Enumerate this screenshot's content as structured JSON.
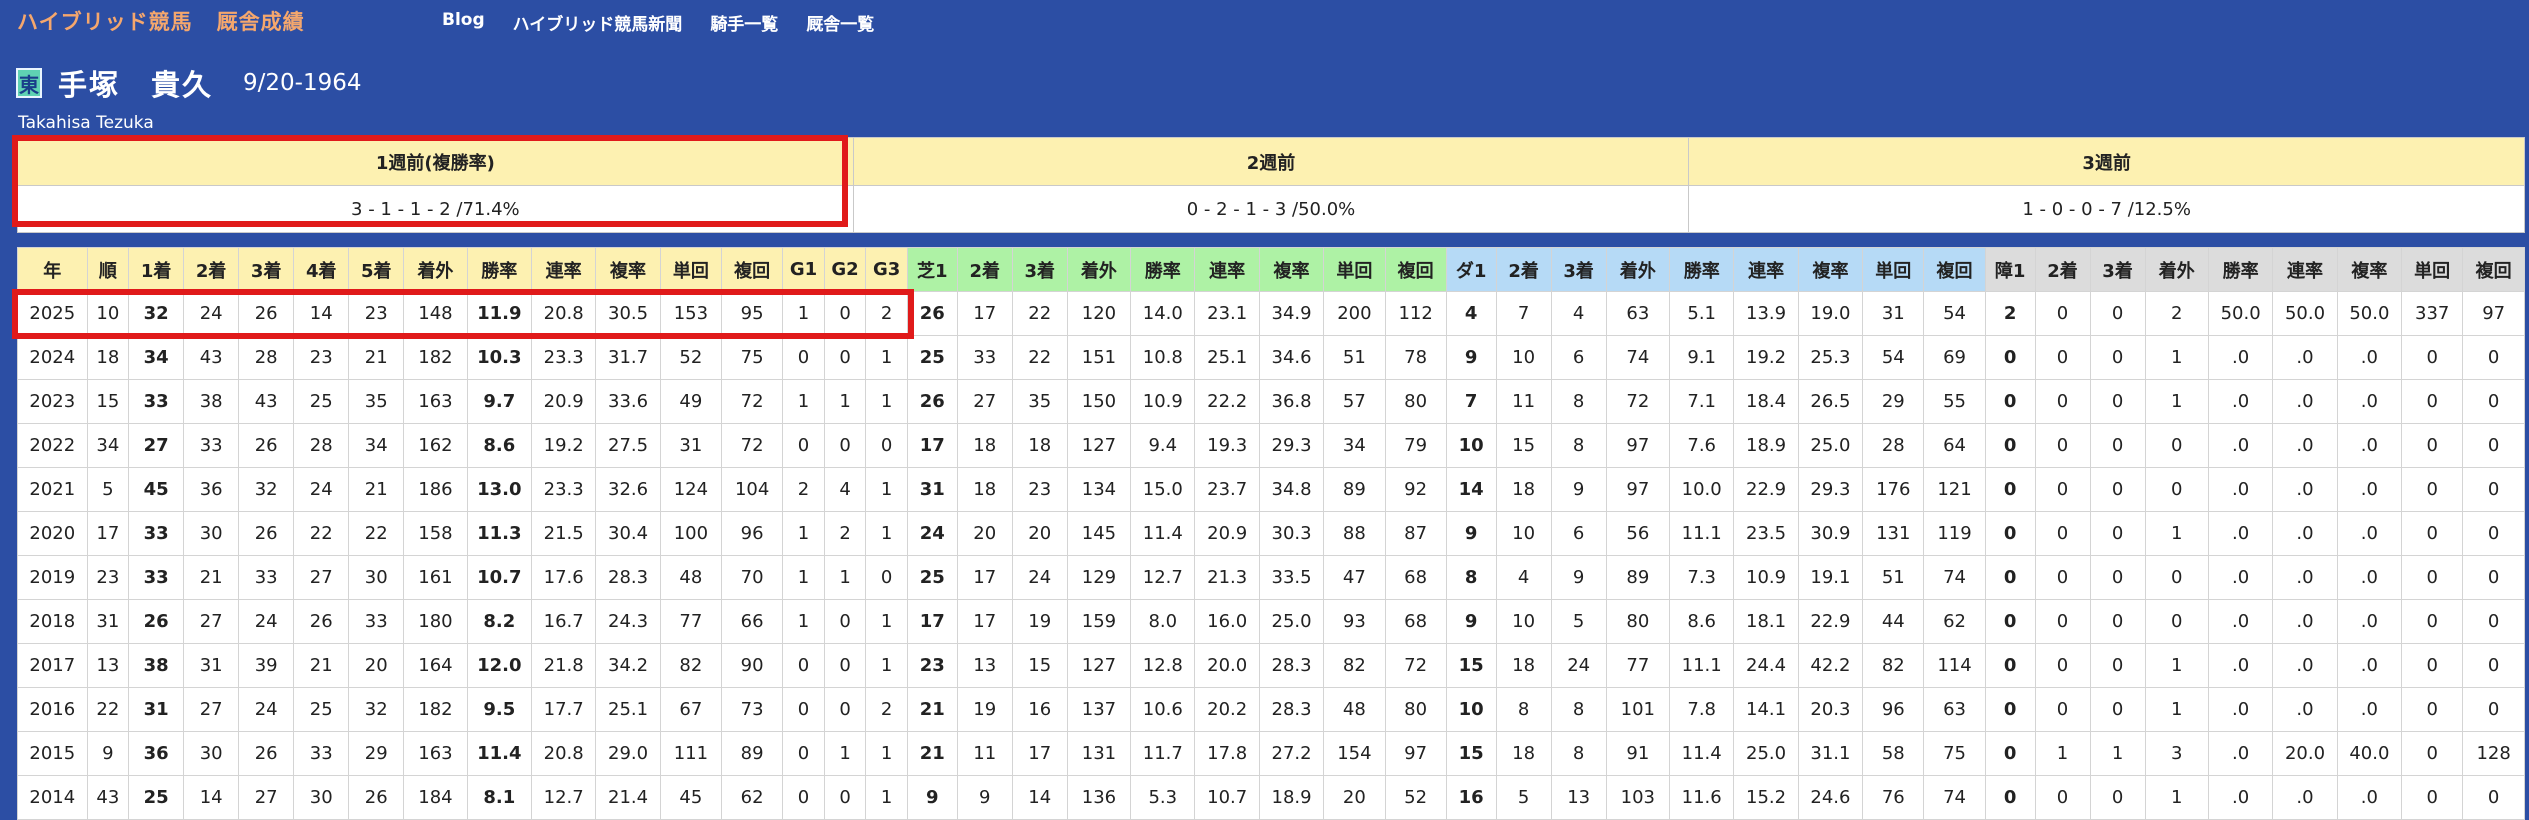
{
  "header": {
    "brand_main": "ハイブリッド競馬",
    "brand_sub": "厩舎成績",
    "nav": [
      "Blog",
      "ハイブリッド競馬新聞",
      "騎手一覧",
      "厩舎一覧"
    ]
  },
  "trainer": {
    "affiliation": "東",
    "name": "手塚　貴久",
    "dob": "9/20-1964",
    "romaji": "Takahisa Tezuka"
  },
  "weeks": {
    "headers": [
      "1週前(複勝率)",
      "2週前",
      "3週前"
    ],
    "values": [
      "3 - 1 - 1 - 2 /71.4%",
      "0 - 2 - 1 - 3 /50.0%",
      "1 - 0 - 0 - 7 /12.5%"
    ]
  },
  "stats": {
    "columns": [
      "年",
      "順",
      "1着",
      "2着",
      "3着",
      "4着",
      "5着",
      "着外",
      "勝率",
      "連率",
      "複率",
      "単回",
      "複回",
      "G1",
      "G2",
      "G3",
      "芝1",
      "2着",
      "3着",
      "着外",
      "勝率",
      "連率",
      "複率",
      "単回",
      "複回",
      "ダ1",
      "2着",
      "3着",
      "着外",
      "勝率",
      "連率",
      "複率",
      "単回",
      "複回",
      "障1",
      "2着",
      "3着",
      "着外",
      "勝率",
      "連率",
      "複率",
      "単回",
      "複回"
    ],
    "group_colors": {
      "overall": "#fdf1b1",
      "turf": "#aef2a5",
      "dirt": "#b6daf6",
      "jump": "#dcdcdc"
    },
    "rows": [
      [
        "2025",
        "10",
        "32",
        "24",
        "26",
        "14",
        "23",
        "148",
        "11.9",
        "20.8",
        "30.5",
        "153",
        "95",
        "1",
        "0",
        "2",
        "26",
        "17",
        "22",
        "120",
        "14.0",
        "23.1",
        "34.9",
        "200",
        "112",
        "4",
        "7",
        "4",
        "63",
        "5.1",
        "13.9",
        "19.0",
        "31",
        "54",
        "2",
        "0",
        "0",
        "2",
        "50.0",
        "50.0",
        "50.0",
        "337",
        "97"
      ],
      [
        "2024",
        "18",
        "34",
        "43",
        "28",
        "23",
        "21",
        "182",
        "10.3",
        "23.3",
        "31.7",
        "52",
        "75",
        "0",
        "0",
        "1",
        "25",
        "33",
        "22",
        "151",
        "10.8",
        "25.1",
        "34.6",
        "51",
        "78",
        "9",
        "10",
        "6",
        "74",
        "9.1",
        "19.2",
        "25.3",
        "54",
        "69",
        "0",
        "0",
        "0",
        "1",
        ".0",
        ".0",
        ".0",
        "0",
        "0"
      ],
      [
        "2023",
        "15",
        "33",
        "38",
        "43",
        "25",
        "35",
        "163",
        "9.7",
        "20.9",
        "33.6",
        "49",
        "72",
        "1",
        "1",
        "1",
        "26",
        "27",
        "35",
        "150",
        "10.9",
        "22.2",
        "36.8",
        "57",
        "80",
        "7",
        "11",
        "8",
        "72",
        "7.1",
        "18.4",
        "26.5",
        "29",
        "55",
        "0",
        "0",
        "0",
        "1",
        ".0",
        ".0",
        ".0",
        "0",
        "0"
      ],
      [
        "2022",
        "34",
        "27",
        "33",
        "26",
        "28",
        "34",
        "162",
        "8.6",
        "19.2",
        "27.5",
        "31",
        "72",
        "0",
        "0",
        "0",
        "17",
        "18",
        "18",
        "127",
        "9.4",
        "19.3",
        "29.3",
        "34",
        "79",
        "10",
        "15",
        "8",
        "97",
        "7.6",
        "18.9",
        "25.0",
        "28",
        "64",
        "0",
        "0",
        "0",
        "0",
        ".0",
        ".0",
        ".0",
        "0",
        "0"
      ],
      [
        "2021",
        "5",
        "45",
        "36",
        "32",
        "24",
        "21",
        "186",
        "13.0",
        "23.3",
        "32.6",
        "124",
        "104",
        "2",
        "4",
        "1",
        "31",
        "18",
        "23",
        "134",
        "15.0",
        "23.7",
        "34.8",
        "89",
        "92",
        "14",
        "18",
        "9",
        "97",
        "10.0",
        "22.9",
        "29.3",
        "176",
        "121",
        "0",
        "0",
        "0",
        "0",
        ".0",
        ".0",
        ".0",
        "0",
        "0"
      ],
      [
        "2020",
        "17",
        "33",
        "30",
        "26",
        "22",
        "22",
        "158",
        "11.3",
        "21.5",
        "30.4",
        "100",
        "96",
        "1",
        "2",
        "1",
        "24",
        "20",
        "20",
        "145",
        "11.4",
        "20.9",
        "30.3",
        "88",
        "87",
        "9",
        "10",
        "6",
        "56",
        "11.1",
        "23.5",
        "30.9",
        "131",
        "119",
        "0",
        "0",
        "0",
        "1",
        ".0",
        ".0",
        ".0",
        "0",
        "0"
      ],
      [
        "2019",
        "23",
        "33",
        "21",
        "33",
        "27",
        "30",
        "161",
        "10.7",
        "17.6",
        "28.3",
        "48",
        "70",
        "1",
        "1",
        "0",
        "25",
        "17",
        "24",
        "129",
        "12.7",
        "21.3",
        "33.5",
        "47",
        "68",
        "8",
        "4",
        "9",
        "89",
        "7.3",
        "10.9",
        "19.1",
        "51",
        "74",
        "0",
        "0",
        "0",
        "0",
        ".0",
        ".0",
        ".0",
        "0",
        "0"
      ],
      [
        "2018",
        "31",
        "26",
        "27",
        "24",
        "26",
        "33",
        "180",
        "8.2",
        "16.7",
        "24.3",
        "77",
        "66",
        "1",
        "0",
        "1",
        "17",
        "17",
        "19",
        "159",
        "8.0",
        "16.0",
        "25.0",
        "93",
        "68",
        "9",
        "10",
        "5",
        "80",
        "8.6",
        "18.1",
        "22.9",
        "44",
        "62",
        "0",
        "0",
        "0",
        "0",
        ".0",
        ".0",
        ".0",
        "0",
        "0"
      ],
      [
        "2017",
        "13",
        "38",
        "31",
        "39",
        "21",
        "20",
        "164",
        "12.0",
        "21.8",
        "34.2",
        "82",
        "90",
        "0",
        "0",
        "1",
        "23",
        "13",
        "15",
        "127",
        "12.8",
        "20.0",
        "28.3",
        "82",
        "72",
        "15",
        "18",
        "24",
        "77",
        "11.1",
        "24.4",
        "42.2",
        "82",
        "114",
        "0",
        "0",
        "0",
        "1",
        ".0",
        ".0",
        ".0",
        "0",
        "0"
      ],
      [
        "2016",
        "22",
        "31",
        "27",
        "24",
        "25",
        "32",
        "182",
        "9.5",
        "17.7",
        "25.1",
        "67",
        "73",
        "0",
        "0",
        "2",
        "21",
        "19",
        "16",
        "137",
        "10.6",
        "20.2",
        "28.3",
        "48",
        "80",
        "10",
        "8",
        "8",
        "101",
        "7.8",
        "14.1",
        "20.3",
        "96",
        "63",
        "0",
        "0",
        "0",
        "1",
        ".0",
        ".0",
        ".0",
        "0",
        "0"
      ],
      [
        "2015",
        "9",
        "36",
        "30",
        "26",
        "33",
        "29",
        "163",
        "11.4",
        "20.8",
        "29.0",
        "111",
        "89",
        "0",
        "1",
        "1",
        "21",
        "11",
        "17",
        "131",
        "11.7",
        "17.8",
        "27.2",
        "154",
        "97",
        "15",
        "18",
        "8",
        "91",
        "11.4",
        "25.0",
        "31.1",
        "58",
        "75",
        "0",
        "1",
        "1",
        "3",
        ".0",
        "20.0",
        "40.0",
        "0",
        "128"
      ],
      [
        "2014",
        "43",
        "25",
        "14",
        "27",
        "30",
        "26",
        "184",
        "8.1",
        "12.7",
        "21.4",
        "45",
        "62",
        "0",
        "0",
        "1",
        "9",
        "9",
        "14",
        "136",
        "5.3",
        "10.7",
        "18.9",
        "20",
        "52",
        "16",
        "5",
        "13",
        "103",
        "11.6",
        "15.2",
        "24.6",
        "76",
        "74",
        "0",
        "0",
        "0",
        "1",
        ".0",
        ".0",
        ".0",
        "0",
        "0"
      ]
    ]
  }
}
